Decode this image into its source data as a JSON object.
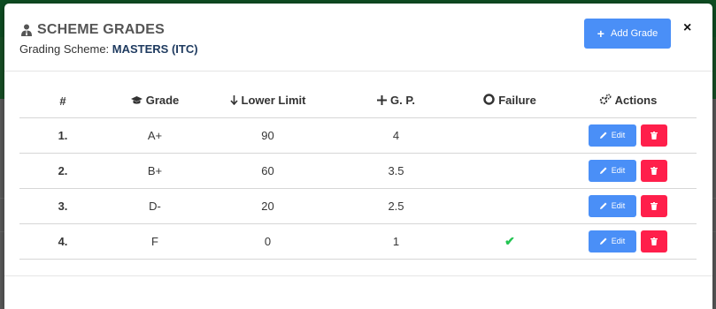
{
  "modal": {
    "title": "SCHEME GRADES",
    "subtitle_prefix": "Grading Scheme: ",
    "scheme_name": "MASTERS (ITC)",
    "add_button_label": "Add Grade",
    "close_label": "×"
  },
  "table": {
    "headers": [
      "#",
      "Grade",
      "Lower Limit",
      "G. P.",
      "Failure",
      "Actions"
    ],
    "header_icons": [
      "",
      "graduation-cap-icon",
      "arrow-down-icon",
      "plus-icon",
      "circle-icon",
      "gears-icon"
    ],
    "rows": [
      {
        "num": "1.",
        "grade": "A+",
        "lower_limit": "90",
        "gp": "4",
        "failure": false
      },
      {
        "num": "2.",
        "grade": "B+",
        "lower_limit": "60",
        "gp": "3.5",
        "failure": false
      },
      {
        "num": "3.",
        "grade": "D-",
        "lower_limit": "20",
        "gp": "2.5",
        "failure": false
      },
      {
        "num": "4.",
        "grade": "F",
        "lower_limit": "0",
        "gp": "1",
        "failure": true
      }
    ],
    "edit_label": "Edit"
  },
  "colors": {
    "primary": "#4a8ff7",
    "danger": "#ff1f4b",
    "success": "#23c552"
  }
}
